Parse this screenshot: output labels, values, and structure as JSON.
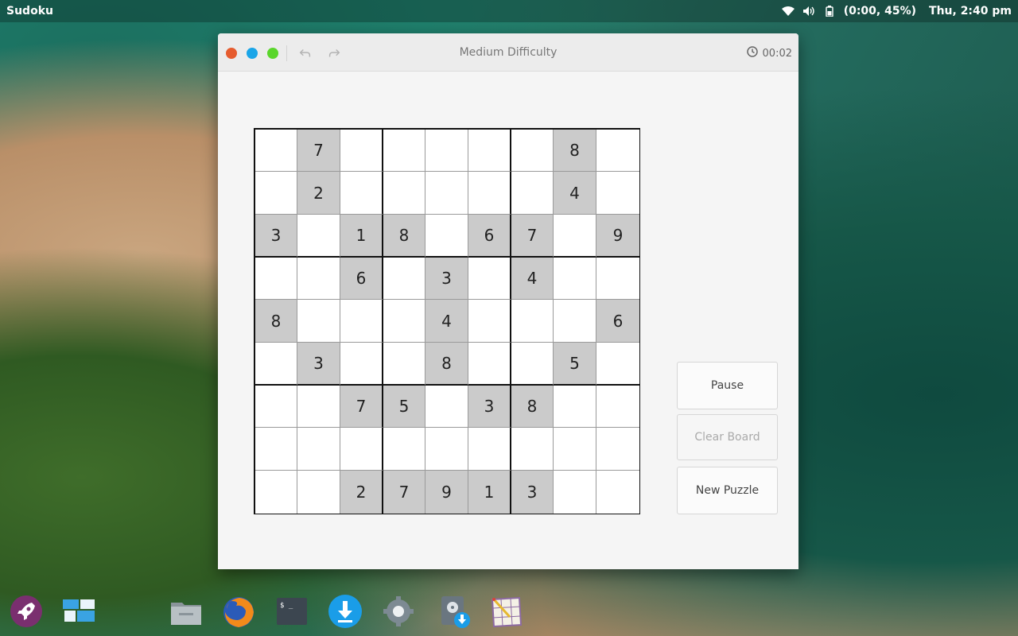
{
  "panel": {
    "app_name": "Sudoku",
    "battery": "(0:00, 45%)",
    "datetime": "Thu,  2:40 pm"
  },
  "window": {
    "title": "Medium Difficulty",
    "timer": "00:02"
  },
  "board": [
    [
      {
        "v": "",
        "g": false
      },
      {
        "v": "7",
        "g": true
      },
      {
        "v": "",
        "g": false
      },
      {
        "v": "",
        "g": false
      },
      {
        "v": "",
        "g": false
      },
      {
        "v": "",
        "g": false
      },
      {
        "v": "",
        "g": false
      },
      {
        "v": "8",
        "g": true
      },
      {
        "v": "",
        "g": false
      }
    ],
    [
      {
        "v": "",
        "g": false
      },
      {
        "v": "2",
        "g": true
      },
      {
        "v": "",
        "g": false
      },
      {
        "v": "",
        "g": false
      },
      {
        "v": "",
        "g": false
      },
      {
        "v": "",
        "g": false
      },
      {
        "v": "",
        "g": false
      },
      {
        "v": "4",
        "g": true
      },
      {
        "v": "",
        "g": false
      }
    ],
    [
      {
        "v": "3",
        "g": true
      },
      {
        "v": "",
        "g": false
      },
      {
        "v": "1",
        "g": true
      },
      {
        "v": "8",
        "g": true
      },
      {
        "v": "",
        "g": false
      },
      {
        "v": "6",
        "g": true
      },
      {
        "v": "7",
        "g": true
      },
      {
        "v": "",
        "g": false
      },
      {
        "v": "9",
        "g": true
      }
    ],
    [
      {
        "v": "",
        "g": false
      },
      {
        "v": "",
        "g": false
      },
      {
        "v": "6",
        "g": true
      },
      {
        "v": "",
        "g": false
      },
      {
        "v": "3",
        "g": true
      },
      {
        "v": "",
        "g": false
      },
      {
        "v": "4",
        "g": true
      },
      {
        "v": "",
        "g": false
      },
      {
        "v": "",
        "g": false
      }
    ],
    [
      {
        "v": "8",
        "g": true
      },
      {
        "v": "",
        "g": false
      },
      {
        "v": "",
        "g": false
      },
      {
        "v": "",
        "g": false
      },
      {
        "v": "4",
        "g": true
      },
      {
        "v": "",
        "g": false
      },
      {
        "v": "",
        "g": false
      },
      {
        "v": "",
        "g": false
      },
      {
        "v": "6",
        "g": true
      }
    ],
    [
      {
        "v": "",
        "g": false
      },
      {
        "v": "3",
        "g": true
      },
      {
        "v": "",
        "g": false
      },
      {
        "v": "",
        "g": false
      },
      {
        "v": "8",
        "g": true
      },
      {
        "v": "",
        "g": false
      },
      {
        "v": "",
        "g": false
      },
      {
        "v": "5",
        "g": true
      },
      {
        "v": "",
        "g": false
      }
    ],
    [
      {
        "v": "",
        "g": false
      },
      {
        "v": "",
        "g": false
      },
      {
        "v": "7",
        "g": true
      },
      {
        "v": "5",
        "g": true
      },
      {
        "v": "",
        "g": false
      },
      {
        "v": "3",
        "g": true
      },
      {
        "v": "8",
        "g": true
      },
      {
        "v": "",
        "g": false
      },
      {
        "v": "",
        "g": false
      }
    ],
    [
      {
        "v": "",
        "g": false
      },
      {
        "v": "",
        "g": false
      },
      {
        "v": "",
        "g": false
      },
      {
        "v": "",
        "g": false
      },
      {
        "v": "",
        "g": false
      },
      {
        "v": "",
        "g": false
      },
      {
        "v": "",
        "g": false
      },
      {
        "v": "",
        "g": false
      },
      {
        "v": "",
        "g": false
      }
    ],
    [
      {
        "v": "",
        "g": false
      },
      {
        "v": "",
        "g": false
      },
      {
        "v": "2",
        "g": true
      },
      {
        "v": "7",
        "g": true
      },
      {
        "v": "9",
        "g": true
      },
      {
        "v": "1",
        "g": true
      },
      {
        "v": "3",
        "g": true
      },
      {
        "v": "",
        "g": false
      },
      {
        "v": "",
        "g": false
      }
    ]
  ],
  "buttons": {
    "pause": "Pause",
    "clear": "Clear Board",
    "new_puzzle": "New Puzzle"
  },
  "dock": [
    {
      "name": "rocket-launcher-icon"
    },
    {
      "name": "multitasking-view-icon"
    },
    {
      "name": "files-folder-icon"
    },
    {
      "name": "firefox-icon"
    },
    {
      "name": "terminal-icon"
    },
    {
      "name": "download-manager-icon"
    },
    {
      "name": "settings-gear-icon"
    },
    {
      "name": "installer-icon"
    },
    {
      "name": "sudoku-app-icon"
    }
  ],
  "colors": {
    "close": "#e65c2f",
    "minimize": "#1aa5e8",
    "maximize": "#5ad62b",
    "given_cell": "#cbcbcb"
  }
}
